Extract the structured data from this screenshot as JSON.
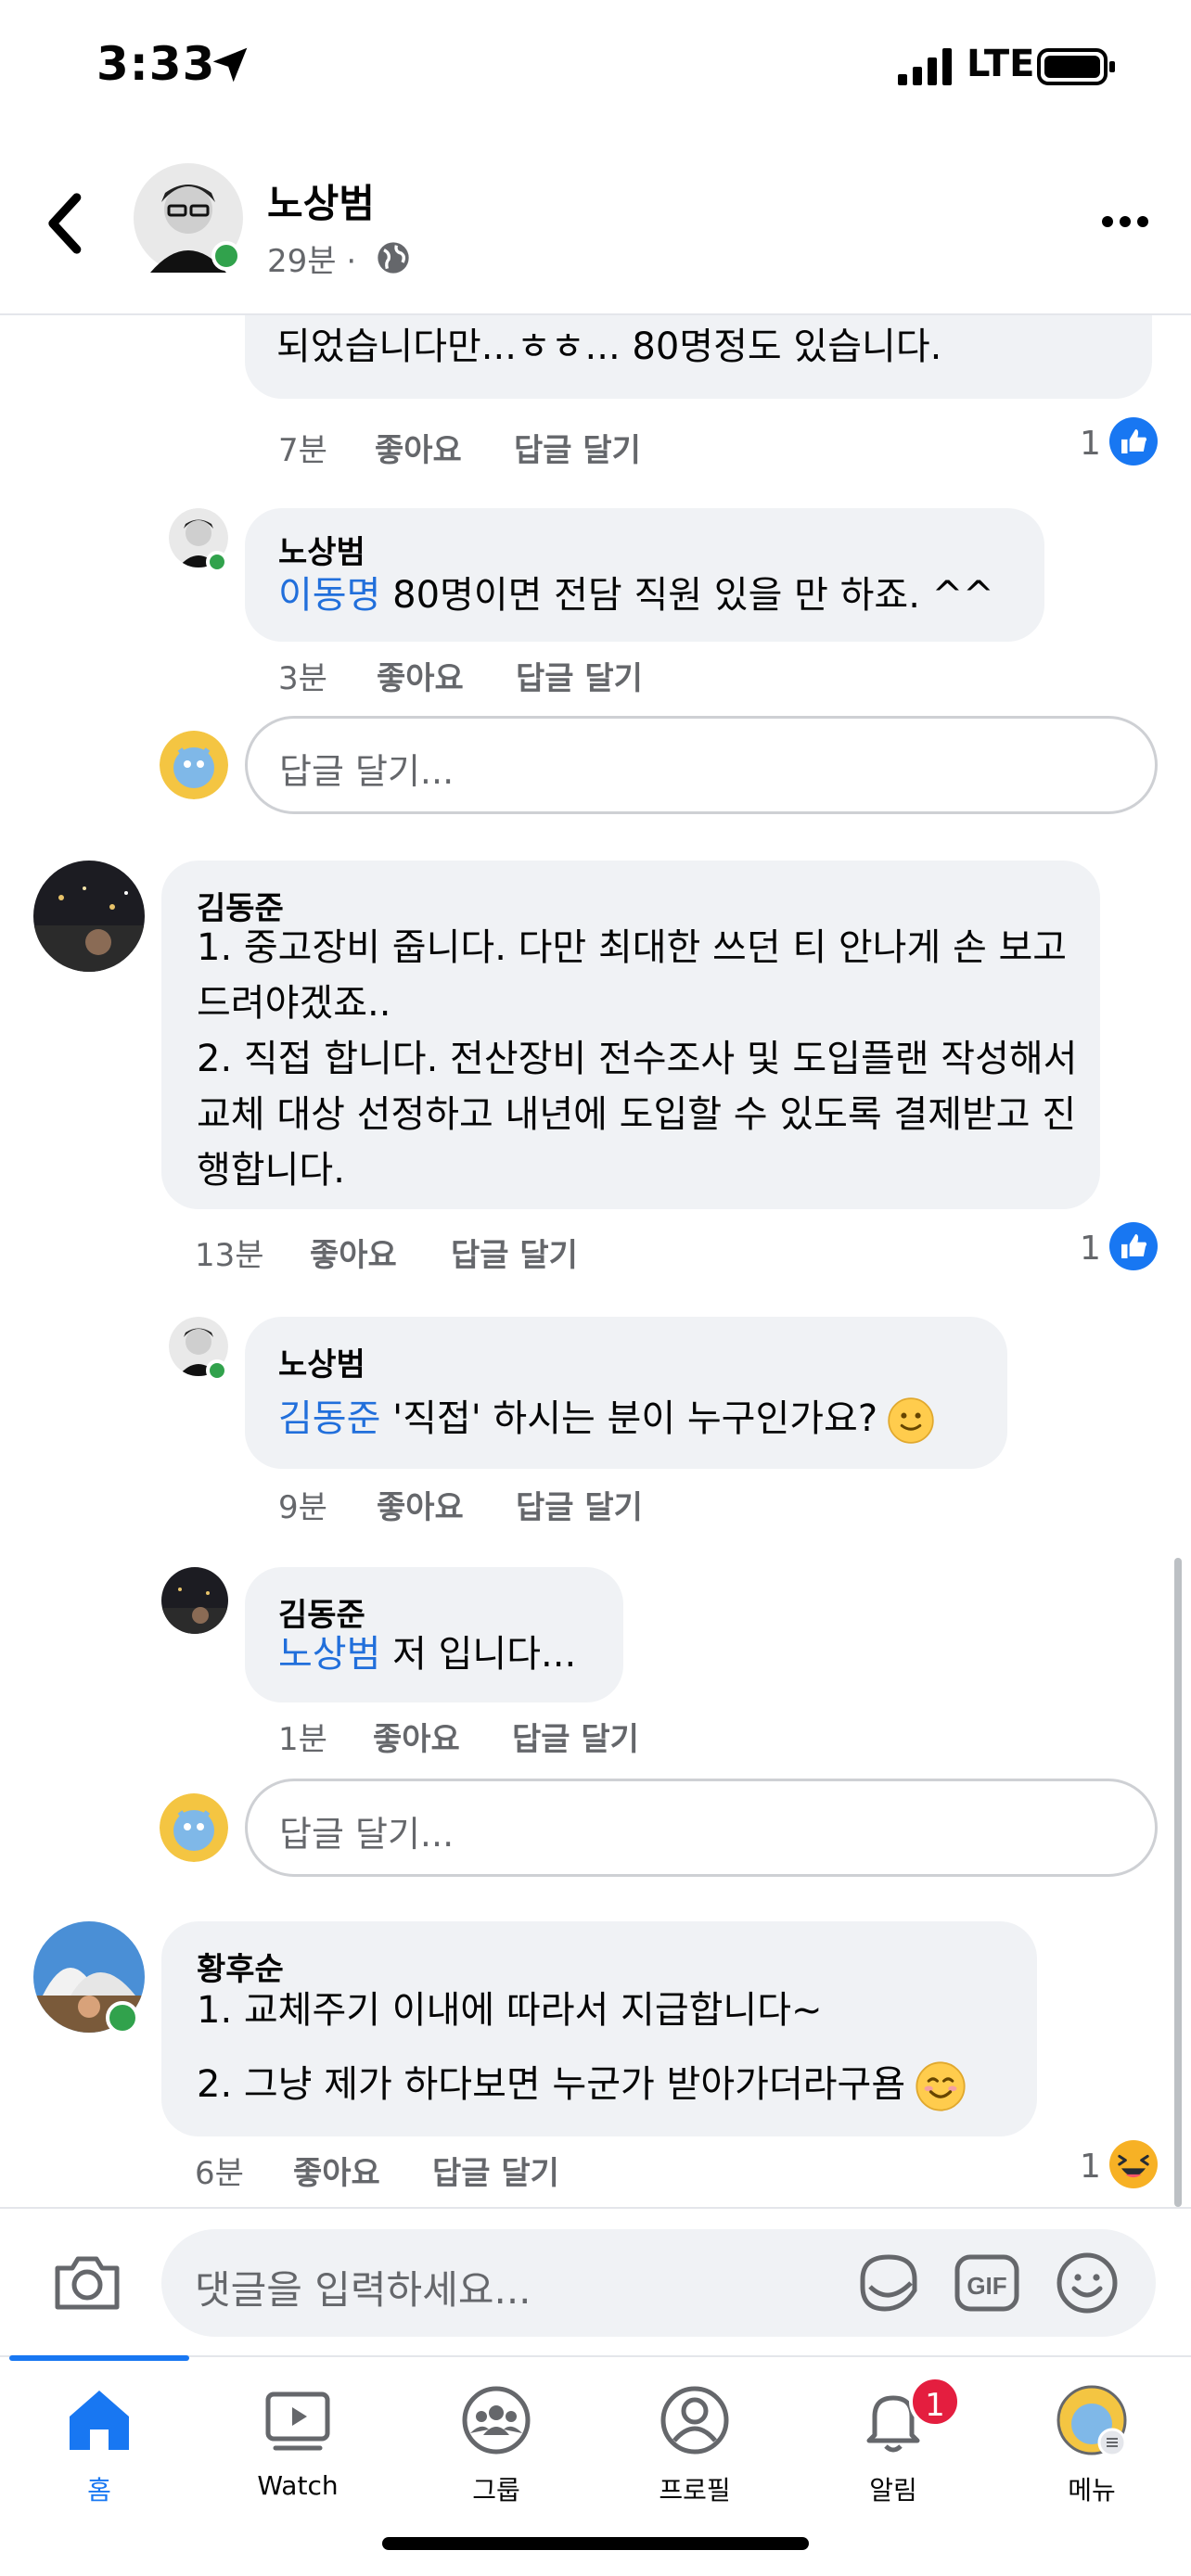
{
  "status_bar": {
    "time": "3:33",
    "network": "LTE"
  },
  "header": {
    "name": "노상범",
    "time": "29분 ·"
  },
  "comments": {
    "c0": {
      "text_line1": "되었습니다만...ㅎㅎ... 80명정도 있습니다.",
      "time": "7분",
      "like": "좋아요",
      "reply": "답글 달기",
      "reaction_count": "1"
    },
    "c1": {
      "name": "노상범",
      "mention": "이동명",
      "text": " 80명이면 전담 직원 있을 만 하죠. ^^",
      "time": "3분",
      "like": "좋아요",
      "reply": "답글 달기"
    },
    "reply_box_1": {
      "placeholder": "답글 달기..."
    },
    "c2": {
      "name": "김동준",
      "lines": [
        "1. 중고장비 줍니다. 다만 최대한 쓰던 티 안나게 손 보고",
        "드려야겠죠..",
        "2. 직접 합니다. 전산장비 전수조사 및 도입플랜 작성해서",
        "교체 대상 선정하고 내년에 도입할 수 있도록 결제받고 진",
        "행합니다."
      ],
      "time": "13분",
      "like": "좋아요",
      "reply": "답글 달기",
      "reaction_count": "1"
    },
    "c3": {
      "name": "노상범",
      "mention": "김동준",
      "text": " '직접' 하시는 분이 누구인가요?",
      "time": "9분",
      "like": "좋아요",
      "reply": "답글 달기"
    },
    "c4": {
      "name": "김동준",
      "mention": "노상범",
      "text": " 저 입니다...",
      "time": "1분",
      "like": "좋아요",
      "reply": "답글 달기"
    },
    "reply_box_2": {
      "placeholder": "답글 달기..."
    },
    "c5": {
      "name": "황후순",
      "line1": "1. 교체주기 이내에 따라서 지급합니다~",
      "line2": "2. 그냥 제가 하다보면 누군가 받아가더라구욤",
      "time": "6분",
      "like": "좋아요",
      "reply": "답글 달기",
      "reaction_count": "1"
    }
  },
  "composer": {
    "placeholder": "댓글을 입력하세요..."
  },
  "tabs": [
    {
      "label": "홈",
      "icon": "home-icon"
    },
    {
      "label": "Watch",
      "icon": "watch-icon"
    },
    {
      "label": "그룹",
      "icon": "groups-icon"
    },
    {
      "label": "프로필",
      "icon": "profile-icon"
    },
    {
      "label": "알림",
      "icon": "bell-icon",
      "badge": "1"
    },
    {
      "label": "메뉴",
      "icon": "menu-avatar-icon"
    }
  ],
  "colors": {
    "accent": "#1877f2",
    "mention": "#216fdb",
    "bubble": "#f0f2f5",
    "online": "#31a24c",
    "badge": "#e41e3f"
  }
}
